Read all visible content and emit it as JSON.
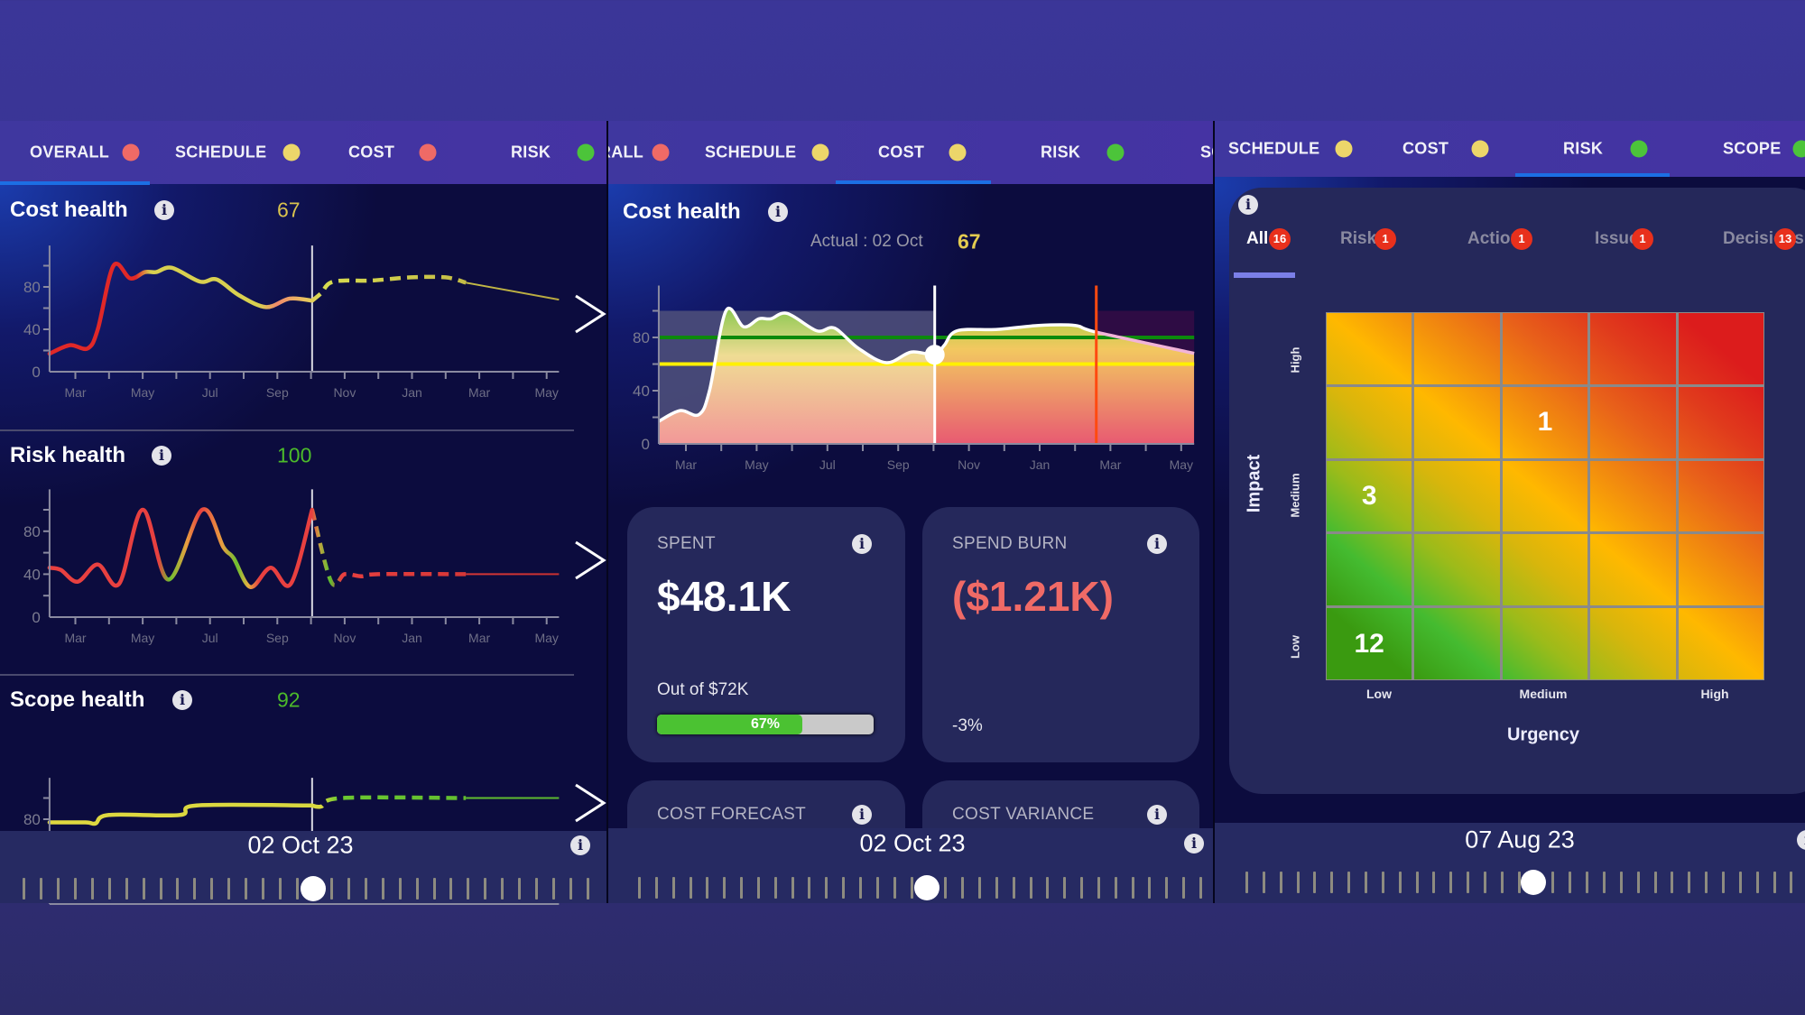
{
  "left_panel": {
    "tabs": [
      {
        "label": "OVERALL",
        "status_color": "#ef6a66"
      },
      {
        "label": "SCHEDULE",
        "status_color": "#ecd66a"
      },
      {
        "label": "COST",
        "status_color": "#ef6a66"
      },
      {
        "label": "RISK",
        "status_color": "#4cc43a"
      }
    ],
    "active_tab": "OVERALL",
    "sections": [
      {
        "title": "Cost health",
        "score": "67",
        "score_color": "#d8c24e"
      },
      {
        "title": "Risk health",
        "score": "100",
        "score_color": "#4cbb2a"
      },
      {
        "title": "Scope health",
        "score": "92",
        "score_color": "#4cbb2a"
      }
    ],
    "date": "02 Oct 23"
  },
  "middle_panel": {
    "tabs": [
      {
        "label": "OVERALL",
        "status_color": "#ef6a66"
      },
      {
        "label": "SCHEDULE",
        "status_color": "#ecd66a"
      },
      {
        "label": "COST",
        "status_color": "#ecd66a"
      },
      {
        "label": "RISK",
        "status_color": "#4cc43a"
      },
      {
        "label": "SCOPE",
        "status_color": "#4cc43a"
      }
    ],
    "active_tab": "COST",
    "title": "Cost health",
    "actual_label": "Actual : 02 Oct",
    "actual_value": "67",
    "cards": [
      {
        "label": "SPENT",
        "value": "$48.1K",
        "sub": "Out of  $72K",
        "progress_percent": 67,
        "progress_label": "67%"
      },
      {
        "label": "SPEND BURN",
        "value": "($1.21K)",
        "value_color": "#f06a66",
        "sub": "-3%"
      },
      {
        "label": "COST FORECAST"
      },
      {
        "label": "COST VARIANCE"
      }
    ],
    "date": "02 Oct 23"
  },
  "right_panel": {
    "tabs": [
      {
        "label": "SCHEDULE",
        "status_color": "#ecd66a"
      },
      {
        "label": "COST",
        "status_color": "#ecd66a"
      },
      {
        "label": "RISK",
        "status_color": "#4cc43a"
      },
      {
        "label": "SCOPE",
        "status_color": "#4cc43a"
      }
    ],
    "active_tab": "RISK",
    "filters": [
      {
        "label": "All",
        "count": "16",
        "active": true
      },
      {
        "label": "Risks",
        "count": "1"
      },
      {
        "label": "Actions",
        "count": "1"
      },
      {
        "label": "Issues",
        "count": "1"
      },
      {
        "label": "Decisions",
        "count": "13"
      }
    ],
    "matrix": {
      "y_title": "Impact",
      "x_title": "Urgency",
      "y_labels": [
        "High",
        "Medium",
        "Low"
      ],
      "x_labels": [
        "Low",
        "Medium",
        "High"
      ],
      "counts": [
        [
          null,
          null,
          null,
          null,
          null
        ],
        [
          null,
          null,
          "1",
          null,
          null
        ],
        [
          "3",
          null,
          null,
          null,
          null
        ],
        [
          null,
          null,
          null,
          null,
          null
        ],
        [
          "12",
          null,
          null,
          null,
          null
        ]
      ],
      "palette": [
        "#3a9a10",
        "#44bb30",
        "#9cbb1a",
        "#d8b60c",
        "#ffb800",
        "#f28c0e",
        "#e8601a",
        "#e03a1c",
        "#dc1c1c"
      ]
    },
    "date": "07 Aug 23"
  },
  "chart_data": [
    {
      "id": "left-cost-health",
      "type": "line",
      "xlim": [
        "2023-02-08",
        "2024-05-12"
      ],
      "ylim": [
        0,
        120
      ],
      "y_ticks": [
        0,
        40,
        80
      ],
      "x_ticks": [
        {
          "date": "2023-03-01",
          "label": "Mar"
        },
        {
          "date": "2023-05-01",
          "label": "May"
        },
        {
          "date": "2023-07-01",
          "label": "Jul"
        },
        {
          "date": "2023-09-01",
          "label": "Sep"
        },
        {
          "date": "2023-11-01",
          "label": "Nov"
        },
        {
          "date": "2024-01-01",
          "label": "Jan"
        },
        {
          "date": "2024-03-01",
          "label": "Mar"
        },
        {
          "date": "2024-05-01",
          "label": "May"
        }
      ],
      "current_date": "2023-10-02",
      "color_stops": [
        [
          "2023-02-08",
          "#e02828"
        ],
        [
          "2023-04-25",
          "#e02828"
        ],
        [
          "2023-05-08",
          "#d8d050"
        ],
        [
          "2023-08-15",
          "#d8d050"
        ],
        [
          "2023-09-01",
          "#f08a6a"
        ],
        [
          "2023-09-25",
          "#e8c060"
        ],
        [
          "2023-10-10",
          "#d8dc50"
        ],
        [
          "2024-05-12",
          "#b8a840"
        ]
      ],
      "actual": [
        [
          "2023-02-08",
          17
        ],
        [
          "2023-02-26",
          25
        ],
        [
          "2023-03-12",
          22
        ],
        [
          "2023-03-21",
          40
        ],
        [
          "2023-04-05",
          100
        ],
        [
          "2023-04-20",
          88
        ],
        [
          "2023-05-03",
          94
        ],
        [
          "2023-05-13",
          94
        ],
        [
          "2023-05-27",
          98
        ],
        [
          "2023-06-22",
          85
        ],
        [
          "2023-07-07",
          87
        ],
        [
          "2023-07-27",
          72
        ],
        [
          "2023-08-21",
          61
        ],
        [
          "2023-09-12",
          69
        ],
        [
          "2023-10-02",
          67
        ]
      ],
      "forecast": [
        [
          "2023-10-02",
          67
        ],
        [
          "2023-10-10",
          74
        ],
        [
          "2023-10-21",
          85
        ],
        [
          "2023-11-25",
          86
        ],
        [
          "2023-12-30",
          89
        ],
        [
          "2024-02-01",
          89
        ],
        [
          "2024-02-19",
          84
        ]
      ],
      "projection": [
        [
          "2024-02-19",
          84
        ],
        [
          "2024-05-12",
          68
        ]
      ]
    },
    {
      "id": "left-risk-health",
      "type": "line",
      "xlim": [
        "2023-02-08",
        "2024-05-12"
      ],
      "ylim": [
        0,
        120
      ],
      "y_ticks": [
        0,
        40,
        80
      ],
      "x_ticks": [
        {
          "date": "2023-03-01",
          "label": "Mar"
        },
        {
          "date": "2023-05-01",
          "label": "May"
        },
        {
          "date": "2023-07-01",
          "label": "Jul"
        },
        {
          "date": "2023-09-01",
          "label": "Sep"
        },
        {
          "date": "2023-11-01",
          "label": "Nov"
        },
        {
          "date": "2024-01-01",
          "label": "Jan"
        },
        {
          "date": "2024-03-01",
          "label": "Mar"
        },
        {
          "date": "2024-05-01",
          "label": "May"
        }
      ],
      "current_date": "2023-10-02",
      "color_stops": [
        [
          "2023-02-08",
          "#e84040"
        ],
        [
          "2023-05-15",
          "#e84040"
        ],
        [
          "2023-05-25",
          "#6cc030"
        ],
        [
          "2023-06-10",
          "#e8a040"
        ],
        [
          "2023-06-22",
          "#e84040"
        ],
        [
          "2023-07-12",
          "#e8a040"
        ],
        [
          "2023-07-25",
          "#6cc030"
        ],
        [
          "2023-08-05",
          "#e8b040"
        ],
        [
          "2023-08-15",
          "#e84040"
        ],
        [
          "2023-10-02",
          "#e84040"
        ],
        [
          "2023-10-08",
          "#c8a040"
        ],
        [
          "2023-10-18",
          "#5cc030"
        ],
        [
          "2023-10-28",
          "#e84040"
        ],
        [
          "2024-05-12",
          "#c83030"
        ]
      ],
      "actual": [
        [
          "2023-02-08",
          46
        ],
        [
          "2023-02-18",
          44
        ],
        [
          "2023-03-03",
          33
        ],
        [
          "2023-03-21",
          49
        ],
        [
          "2023-04-10",
          31
        ],
        [
          "2023-05-01",
          100
        ],
        [
          "2023-05-24",
          35
        ],
        [
          "2023-06-24",
          100
        ],
        [
          "2023-07-13",
          65
        ],
        [
          "2023-07-22",
          55
        ],
        [
          "2023-08-07",
          28
        ],
        [
          "2023-08-25",
          46
        ],
        [
          "2023-09-13",
          31
        ],
        [
          "2023-10-02",
          100
        ]
      ],
      "forecast": [
        [
          "2023-10-02",
          100
        ],
        [
          "2023-10-19",
          33
        ],
        [
          "2023-11-01",
          40
        ],
        [
          "2023-11-16",
          38
        ],
        [
          "2023-12-01",
          40
        ],
        [
          "2024-02-19",
          40
        ]
      ],
      "projection": [
        [
          "2024-02-19",
          40
        ],
        [
          "2024-05-12",
          40
        ]
      ]
    },
    {
      "id": "left-scope-health",
      "type": "line",
      "xlim": [
        "2023-02-08",
        "2024-05-12"
      ],
      "ylim": [
        0,
        120
      ],
      "y_ticks": [
        40,
        80
      ],
      "x_ticks": [],
      "current_date": "2023-10-02",
      "color_stops": [
        [
          "2023-02-08",
          "#e0d840"
        ],
        [
          "2023-10-10",
          "#d8d840"
        ],
        [
          "2023-10-25",
          "#6cc830"
        ],
        [
          "2024-05-12",
          "#5cb830"
        ]
      ],
      "actual": [
        [
          "2023-02-08",
          77
        ],
        [
          "2023-03-10",
          77
        ],
        [
          "2023-03-19",
          76
        ],
        [
          "2023-04-01",
          84
        ],
        [
          "2023-06-04",
          84
        ],
        [
          "2023-06-19",
          93
        ],
        [
          "2023-10-02",
          93
        ]
      ],
      "forecast": [
        [
          "2023-10-02",
          93
        ],
        [
          "2023-10-10",
          92
        ],
        [
          "2023-10-29",
          100
        ],
        [
          "2024-02-19",
          100
        ]
      ],
      "projection": [
        [
          "2024-02-19",
          100
        ],
        [
          "2024-05-12",
          100
        ]
      ]
    },
    {
      "id": "middle-cost-health",
      "type": "area",
      "xlim": [
        "2023-02-08",
        "2024-05-12"
      ],
      "ylim": [
        0,
        120
      ],
      "y_ticks": [
        0,
        40,
        80
      ],
      "x_ticks": [
        {
          "date": "2023-03-01",
          "label": "Mar"
        },
        {
          "date": "2023-05-01",
          "label": "May"
        },
        {
          "date": "2023-07-01",
          "label": "Jul"
        },
        {
          "date": "2023-09-01",
          "label": "Sep"
        },
        {
          "date": "2023-11-01",
          "label": "Nov"
        },
        {
          "date": "2024-01-01",
          "label": "Jan"
        },
        {
          "date": "2024-03-01",
          "label": "Mar"
        },
        {
          "date": "2024-05-01",
          "label": "May"
        }
      ],
      "current_date": "2023-10-02",
      "current_value": 67,
      "marker_date": "2024-02-19",
      "marker_color": "#ff4a10",
      "thresholds": [
        {
          "value": 80,
          "color": "#0c8a0c"
        },
        {
          "value": 60,
          "color": "#fff000"
        }
      ],
      "series": [
        [
          "2023-02-08",
          17
        ],
        [
          "2023-02-26",
          25
        ],
        [
          "2023-03-12",
          22
        ],
        [
          "2023-03-21",
          40
        ],
        [
          "2023-04-05",
          100
        ],
        [
          "2023-04-20",
          88
        ],
        [
          "2023-05-03",
          94
        ],
        [
          "2023-05-13",
          94
        ],
        [
          "2023-05-27",
          98
        ],
        [
          "2023-06-22",
          85
        ],
        [
          "2023-07-07",
          87
        ],
        [
          "2023-07-27",
          72
        ],
        [
          "2023-08-21",
          61
        ],
        [
          "2023-09-12",
          69
        ],
        [
          "2023-10-02",
          67
        ],
        [
          "2023-10-10",
          74
        ],
        [
          "2023-10-21",
          85
        ],
        [
          "2023-11-25",
          86
        ],
        [
          "2023-12-30",
          89
        ],
        [
          "2024-02-01",
          89
        ],
        [
          "2024-02-19",
          84
        ],
        [
          "2024-05-12",
          68
        ]
      ]
    }
  ]
}
